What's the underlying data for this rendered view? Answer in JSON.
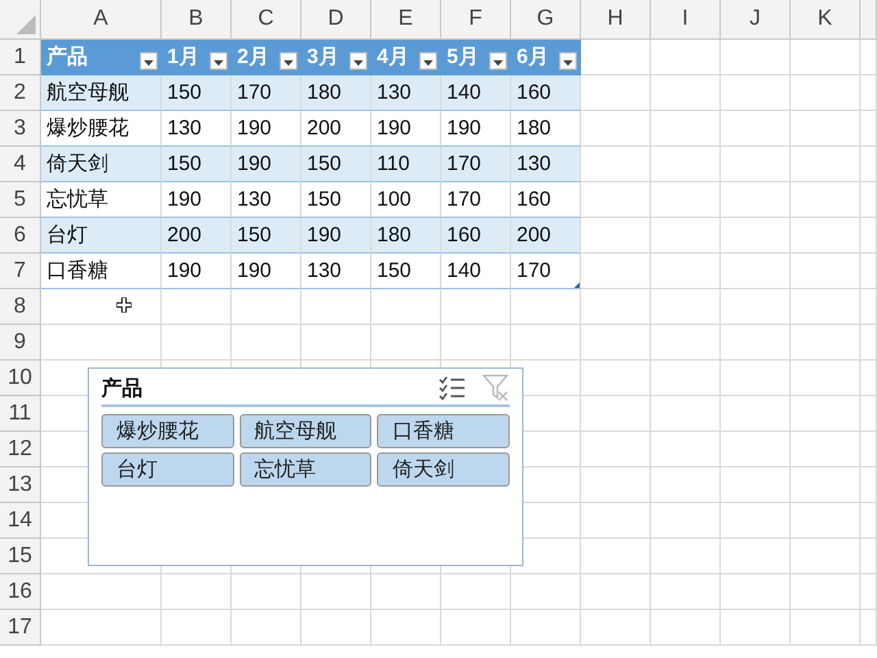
{
  "sheet": {
    "columns": [
      "A",
      "B",
      "C",
      "D",
      "E",
      "F",
      "G",
      "H",
      "I",
      "J",
      "K"
    ],
    "row_numbers": [
      "1",
      "2",
      "3",
      "4",
      "5",
      "6",
      "7",
      "8",
      "9",
      "10",
      "11",
      "12",
      "13",
      "14",
      "15",
      "16",
      "17"
    ]
  },
  "table": {
    "headers": [
      "产品",
      "1月",
      "2月",
      "3月",
      "4月",
      "5月",
      "6月"
    ],
    "rows": [
      [
        "航空母舰",
        "150",
        "170",
        "180",
        "130",
        "140",
        "160"
      ],
      [
        "爆炒腰花",
        "130",
        "190",
        "200",
        "190",
        "190",
        "180"
      ],
      [
        "倚天剑",
        "150",
        "190",
        "150",
        "110",
        "170",
        "130"
      ],
      [
        "忘忧草",
        "190",
        "130",
        "150",
        "100",
        "170",
        "160"
      ],
      [
        "台灯",
        "200",
        "150",
        "190",
        "180",
        "160",
        "200"
      ],
      [
        "口香糖",
        "190",
        "190",
        "130",
        "150",
        "140",
        "170"
      ]
    ]
  },
  "slicer": {
    "title": "产品",
    "items": [
      {
        "label": "爆炒腰花",
        "selected": true
      },
      {
        "label": "航空母舰",
        "selected": true
      },
      {
        "label": "口香糖",
        "selected": true
      },
      {
        "label": "台灯",
        "selected": true
      },
      {
        "label": "忘忧草",
        "selected": true
      },
      {
        "label": "倚天剑",
        "selected": true
      }
    ]
  }
}
